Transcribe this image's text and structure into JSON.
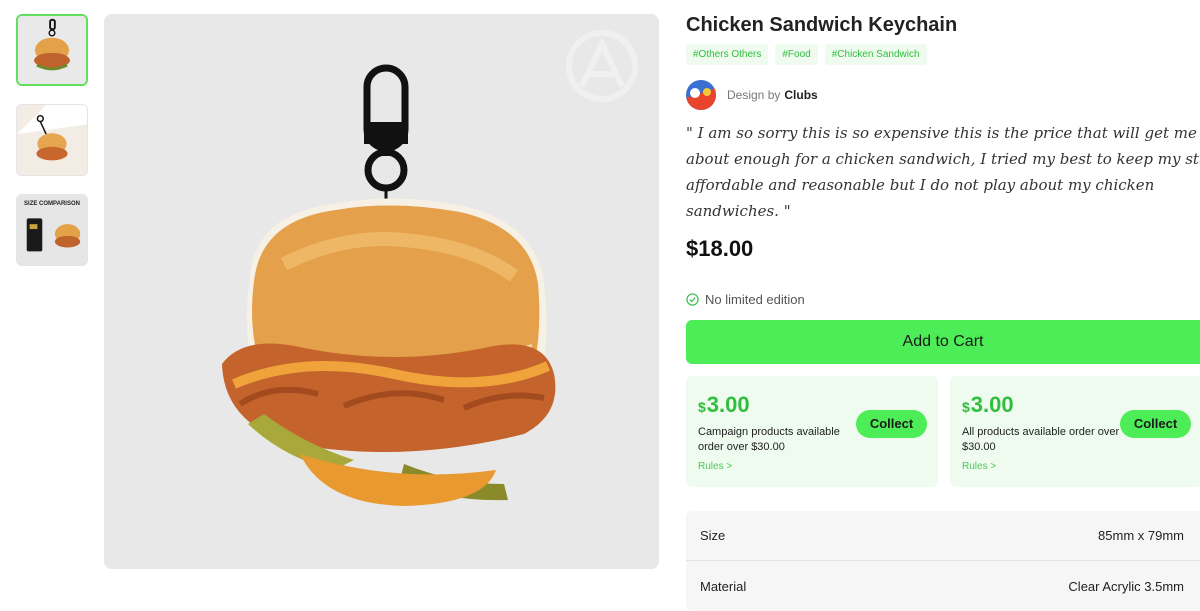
{
  "product": {
    "title": "Chicken Sandwich Keychain",
    "tags": [
      "#Others Others",
      "#Food",
      "#Chicken Sandwich"
    ],
    "designer_prefix": "Design by",
    "designer_name": "Clubs",
    "quote": "\" I am so sorry this is so expensive this is the price that will get me about enough for a chicken sandwich, I tried my best to keep my stuff affordable and reasonable but I do not play about my chicken sandwiches. \"",
    "price": "$18.00",
    "edition": "No limited edition",
    "add_to_cart": "Add to Cart"
  },
  "thumbnails": {
    "size_comparison_caption": "SIZE COMPARISON"
  },
  "coupons": [
    {
      "currency": "$",
      "amount": "3.00",
      "description": "Campaign products available order over $30.00",
      "rules": "Rules >",
      "collect": "Collect"
    },
    {
      "currency": "$",
      "amount": "3.00",
      "description": "All products available order over $30.00",
      "rules": "Rules >",
      "collect": "Collect"
    }
  ],
  "specs": [
    {
      "label": "Size",
      "value": "85mm x 79mm"
    },
    {
      "label": "Material",
      "value": "Clear Acrylic 3.5mm"
    }
  ],
  "colors": {
    "accent": "#4ded57",
    "accent_text": "#2fbf3d",
    "coupon_bg": "#eefbee"
  }
}
